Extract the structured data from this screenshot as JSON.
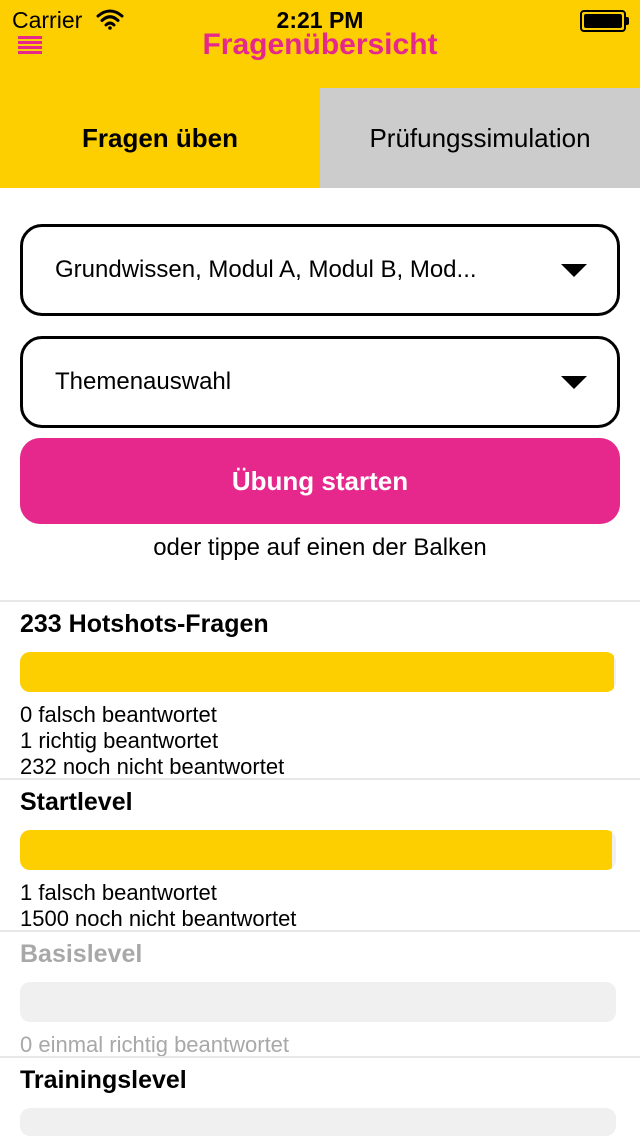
{
  "status_bar": {
    "carrier": "Carrier",
    "time": "2:21 PM"
  },
  "header": {
    "title": "Fragenübersicht",
    "icons": {
      "menu": "hamburger-menu-icon"
    }
  },
  "tabs": [
    {
      "label": "Fragen üben",
      "active": true
    },
    {
      "label": "Prüfungssimulation",
      "active": false
    }
  ],
  "filters": {
    "modules": "Grundwissen, Modul A, Modul B, Mod...",
    "topics": "Themenauswahl"
  },
  "start_button": {
    "label": "Übung starten"
  },
  "hint": "oder tippe auf einen der Balken",
  "levels": [
    {
      "title": "233 Hotshots-Fragen",
      "progress": 0.996,
      "stats": [
        "0 falsch beantwortet",
        "1 richtig beantwortet",
        "232 noch nicht beantwortet"
      ],
      "enabled": true
    },
    {
      "title": "Startlevel",
      "progress": 0.993,
      "stats": [
        "1 falsch beantwortet",
        "1500 noch nicht beantwortet"
      ],
      "enabled": true
    },
    {
      "title": "Basislevel",
      "progress": 0,
      "stats": [
        "0 einmal richtig beantwortet"
      ],
      "enabled": false
    },
    {
      "title": "Trainingslevel",
      "progress": 0,
      "stats": [],
      "enabled": true
    }
  ],
  "colors": {
    "brand_yellow": "#FECF00",
    "brand_pink": "#E6288D",
    "tab_inactive": "#CCCCCC"
  }
}
